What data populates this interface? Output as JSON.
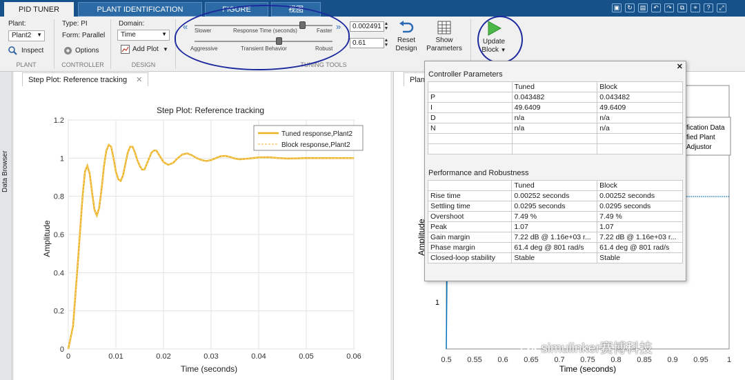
{
  "tabs": [
    {
      "label": "PID TUNER",
      "active": true
    },
    {
      "label": "PLANT IDENTIFICATION",
      "active": false
    },
    {
      "label": "FIGURE",
      "active": false
    },
    {
      "label": "视图",
      "active": false
    }
  ],
  "quick_access": [
    "save-icon",
    "refresh-icon",
    "print-icon",
    "undo-icon",
    "redo-icon",
    "copy-icon",
    "pin-icon",
    "help-icon",
    "expand-icon"
  ],
  "plant": {
    "label": "Plant:",
    "value": "Plant2",
    "inspect": "Inspect",
    "section": "PLANT"
  },
  "controller": {
    "type": "Type: PI",
    "form": "Form: Parallel",
    "options": "Options",
    "section": "CONTROLLER"
  },
  "design": {
    "domain_label": "Domain:",
    "domain_value": "Time",
    "add_plot": "Add Plot",
    "section": "DESIGN"
  },
  "tuning": {
    "section": "TUNING TOOLS",
    "response_time": {
      "left": "Slower",
      "center": "Response Time (seconds)",
      "right": "Faster",
      "value": "0.002491",
      "level": 0.78
    },
    "transient": {
      "left": "Aggressive",
      "center": "Transient Behavior",
      "right": "Robust",
      "value": "0.61",
      "level": 0.61
    }
  },
  "buttons": {
    "reset": "Reset\nDesign",
    "reset_a": "Reset",
    "reset_b": "Design",
    "show_a": "Show",
    "show_b": "Parameters",
    "update_a": "Update",
    "update_b": "Block"
  },
  "left_dock": {
    "label": "Data Browser"
  },
  "plot_tab": {
    "label": "Step Plot: Reference tracking"
  },
  "right_tab": {
    "label": "Plan"
  },
  "chart_data": {
    "type": "line",
    "title": "Step Plot: Reference tracking",
    "xlabel": "Time (seconds)",
    "ylabel": "Amplitude",
    "xlim": [
      0,
      0.06
    ],
    "ylim": [
      0,
      1.2
    ],
    "xticks": [
      "0",
      "0.01",
      "0.02",
      "0.03",
      "0.04",
      "0.05",
      "0.06"
    ],
    "yticks": [
      "0",
      "0.2",
      "0.4",
      "0.6",
      "0.8",
      "1",
      "1.2"
    ],
    "grid": true,
    "legend_position": "top-right",
    "series": [
      {
        "name": "Tuned response,Plant2",
        "color": "#EDB120",
        "style": "solid",
        "x": [
          0,
          0.001,
          0.002,
          0.003,
          0.0035,
          0.004,
          0.0045,
          0.005,
          0.0055,
          0.006,
          0.0065,
          0.007,
          0.0075,
          0.008,
          0.0085,
          0.009,
          0.0095,
          0.01,
          0.0105,
          0.011,
          0.0115,
          0.012,
          0.0125,
          0.013,
          0.0135,
          0.014,
          0.0145,
          0.015,
          0.0155,
          0.016,
          0.0165,
          0.017,
          0.0175,
          0.018,
          0.0185,
          0.019,
          0.0195,
          0.02,
          0.021,
          0.022,
          0.023,
          0.024,
          0.025,
          0.026,
          0.027,
          0.028,
          0.029,
          0.03,
          0.031,
          0.032,
          0.033,
          0.034,
          0.035,
          0.036,
          0.038,
          0.04,
          0.042,
          0.044,
          0.046,
          0.048,
          0.05,
          0.055,
          0.06
        ],
        "y": [
          0,
          0.12,
          0.45,
          0.8,
          0.93,
          0.96,
          0.92,
          0.82,
          0.73,
          0.7,
          0.74,
          0.84,
          0.96,
          1.04,
          1.07,
          1.06,
          1.0,
          0.93,
          0.89,
          0.88,
          0.91,
          0.97,
          1.03,
          1.06,
          1.06,
          1.03,
          0.99,
          0.96,
          0.94,
          0.94,
          0.97,
          1.0,
          1.03,
          1.04,
          1.04,
          1.02,
          1.0,
          0.98,
          0.965,
          0.975,
          1.0,
          1.02,
          1.025,
          1.015,
          1.0,
          0.99,
          0.985,
          0.99,
          1.0,
          1.01,
          1.012,
          1.006,
          0.998,
          0.994,
          0.998,
          1.004,
          1.005,
          1.001,
          0.998,
          0.999,
          1.001,
          1.0,
          1.0
        ]
      },
      {
        "name": "Block response,Plant2",
        "color": "#EDB120",
        "style": "dashed"
      }
    ]
  },
  "right_chart": {
    "ylabel": "Amplitude",
    "xlabel": "Time (seconds)",
    "xticks": [
      "0.5",
      "0.55",
      "0.6",
      "0.65",
      "0.7",
      "0.75",
      "0.8",
      "0.85",
      "0.9",
      "0.95",
      "1"
    ],
    "y_one": "1",
    "legend_partial": [
      "fication Data",
      "fied Plant",
      "Adjustor"
    ]
  },
  "popup": {
    "section1": "Controller Parameters",
    "headers": [
      "",
      "Tuned",
      "Block"
    ],
    "params": [
      [
        "P",
        "0.043482",
        "0.043482"
      ],
      [
        "I",
        "49.6409",
        "49.6409"
      ],
      [
        "D",
        "n/a",
        "n/a"
      ],
      [
        "N",
        "n/a",
        "n/a"
      ],
      [
        "",
        "",
        ""
      ],
      [
        "",
        "",
        ""
      ]
    ],
    "section2": "Performance and Robustness",
    "perf": [
      [
        "Rise time",
        "0.00252 seconds",
        "0.00252 seconds"
      ],
      [
        "Settling time",
        "0.0295 seconds",
        "0.0295 seconds"
      ],
      [
        "Overshoot",
        "7.49 %",
        "7.49 %"
      ],
      [
        "Peak",
        "1.07",
        "1.07"
      ],
      [
        "Gain margin",
        "7.22 dB @ 1.16e+03 r...",
        "7.22 dB @ 1.16e+03 r..."
      ],
      [
        "Phase margin",
        "61.4 deg @ 801 rad/s",
        "61.4 deg @ 801 rad/s"
      ],
      [
        "Closed-loop stability",
        "Stable",
        "Stable"
      ]
    ]
  },
  "watermark": "simulinker赛博科技",
  "colors": {
    "title_bar": "#16518a",
    "annotation": "#1d2a9e",
    "right_series": "#0072BD"
  }
}
